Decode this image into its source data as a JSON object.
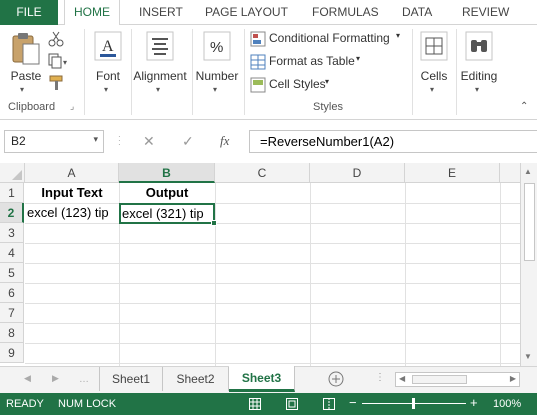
{
  "ribbon_tabs": {
    "file": "FILE",
    "home": "HOME",
    "insert": "INSERT",
    "page_layout": "PAGE LAYOUT",
    "formulas": "FORMULAS",
    "data": "DATA",
    "review": "REVIEW"
  },
  "ribbon": {
    "paste": "Paste",
    "clipboard_group": "Clipboard",
    "font": "Font",
    "alignment": "Alignment",
    "number": "Number",
    "conditional_formatting": "Conditional Formatting",
    "format_as_table": "Format as Table",
    "cell_styles": "Cell Styles",
    "styles_group": "Styles",
    "cells": "Cells",
    "editing": "Editing"
  },
  "formula_bar": {
    "name_box": "B2",
    "fx": "fx",
    "formula": "=ReverseNumber1(A2)"
  },
  "grid": {
    "columns": [
      "A",
      "B",
      "C",
      "D",
      "E"
    ],
    "rows": [
      "1",
      "2",
      "3",
      "4",
      "5",
      "6",
      "7",
      "8",
      "9"
    ],
    "a1": "Input Text",
    "b1": "Output",
    "a2": "excel (123) tip",
    "b2": "excel (321) tip",
    "active_cell": "B2"
  },
  "sheets": [
    "Sheet1",
    "Sheet2",
    "Sheet3"
  ],
  "active_sheet": "Sheet3",
  "status": {
    "ready": "READY",
    "num_lock": "NUM LOCK",
    "zoom": "100%"
  },
  "colors": {
    "accent": "#217346",
    "header_bg": "#f3f3f3"
  }
}
